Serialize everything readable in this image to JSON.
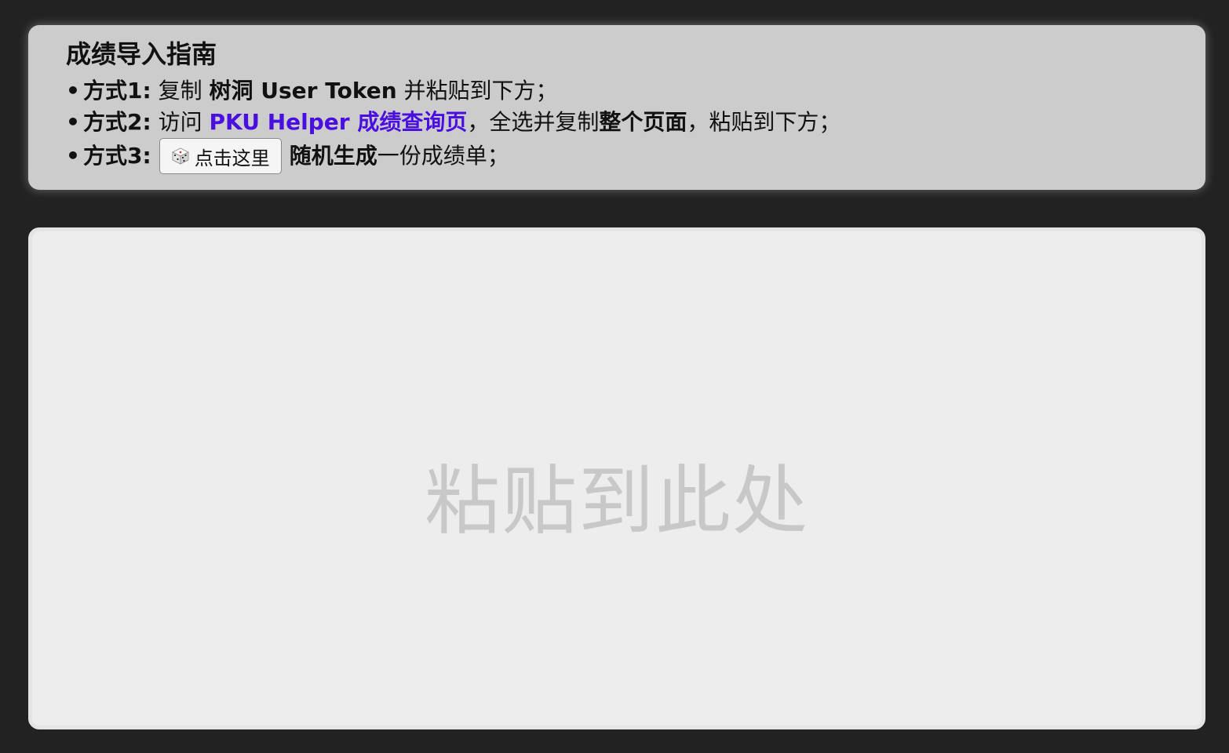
{
  "guide": {
    "title": "成绩导入指南",
    "bullet": "•",
    "method1": {
      "label": "方式1:",
      "text_a": "复制",
      "bold": "树洞 User Token",
      "text_b": "并粘贴到下方；"
    },
    "method2": {
      "label": "方式2:",
      "text_a": "访问",
      "link": "PKU Helper 成绩查询页",
      "text_b": "，全选并复制",
      "bold": "整个页面",
      "text_c": "，粘贴到下方；"
    },
    "method3": {
      "label": "方式3:",
      "button_label": "点击这里",
      "bold": "随机生成",
      "text_b": "一份成绩单；"
    }
  },
  "paste_area": {
    "placeholder": "粘贴到此处"
  },
  "colors": {
    "background": "#222222",
    "guide_bg": "#cccccc",
    "link": "#4a0fe0",
    "paste_bg": "#ededed",
    "placeholder": "#c8c8c8"
  },
  "icons": {
    "dice": "dice-icon"
  }
}
